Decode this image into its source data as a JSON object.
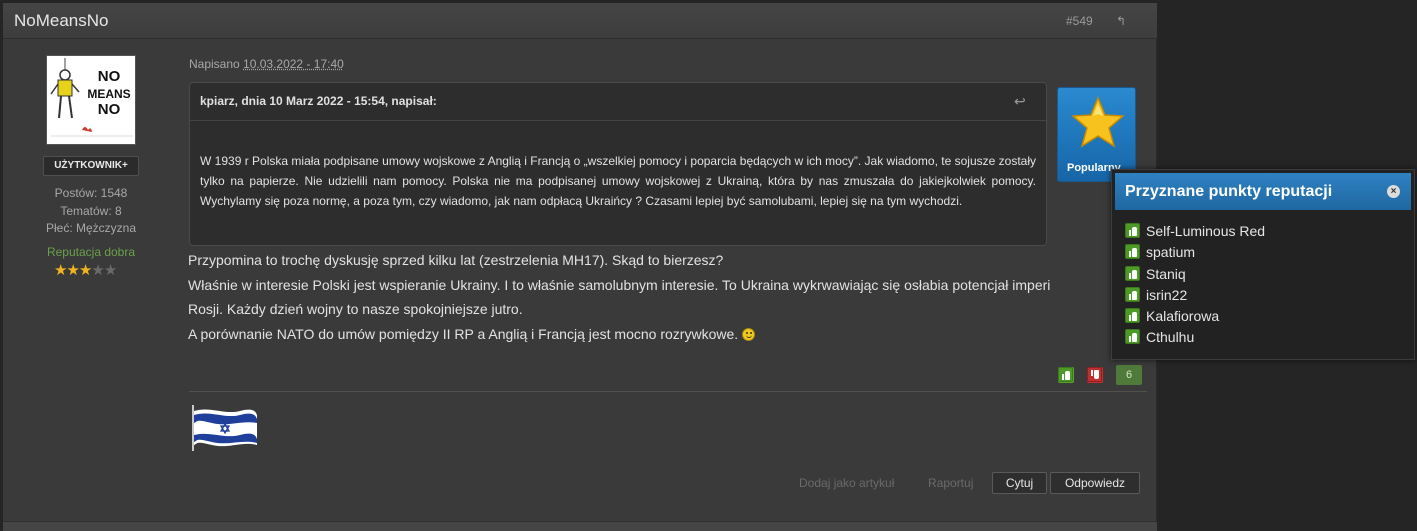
{
  "post": {
    "author": "NoMeansNo",
    "number": "#549",
    "posted_prefix": "Napisano",
    "posted_date": "10.03.2022 - 17:40"
  },
  "author_panel": {
    "avatar_text": [
      "NO",
      "MEANS",
      "NO"
    ],
    "badge": "UŻYTKOWNIK+",
    "posts": "Postów: 1548",
    "topics": "Tematów: 8",
    "gender": "Płeć: Mężczyzna",
    "reputation_label": "Reputacja dobra",
    "reputation_stars": 3,
    "reputation_max": 5
  },
  "quote": {
    "citation": "kpiarz, dnia 10 Marz 2022 - 15:54, napisał:",
    "text": "W  1939 r Polska miała podpisane umowy wojskowe z Anglią i Francją  o „wszelkiej pomocy i poparcia będących w ich mocy”. Jak wiadomo, te sojusze zostały tylko na papierze. Nie udzielili nam pomocy. Polska nie ma podpisanej umowy wojskowej z Ukrainą, która by nas zmuszała do jakiejkolwiek pomocy. Wychylamy się poza normę, a poza tym, czy wiadomo, jak nam odpłacą Ukraińcy ? Czasami lepiej być samolubami, lepiej się na tym wychodzi."
  },
  "popular_badge": "Popularny",
  "body": {
    "lines": [
      "Przypomina to trochę dyskusję sprzed kilku lat (zestrzelenia MH17). Skąd to bierzesz?",
      "Właśnie w interesie Polski jest wspieranie Ukrainy. I to właśnie samolubnym interesie. To Ukraina wykrwawiając się osłabia potencjał imperi",
      "Rosji. Każdy dzień wojny to nasze spokojniejsze jutro.",
      "A porównanie NATO do umów pomiędzy II RP a Anglią i Francją jest mocno rozrywkowe."
    ]
  },
  "reputation": {
    "count": "6"
  },
  "actions": {
    "add_article": "Dodaj jako artykuł",
    "report": "Raportuj",
    "quote": "Cytuj",
    "reply": "Odpowiedz"
  },
  "popup": {
    "title": "Przyznane punkty reputacji",
    "users": [
      "Self-Luminous Red",
      "spatium",
      "Staniq",
      "isrin22",
      "Kalafiorowa",
      "Cthulhu"
    ]
  },
  "colors": {
    "accent_blue": "#2a7fc0",
    "rep_green": "#6aa04a",
    "star_gold": "#f2b51e"
  }
}
